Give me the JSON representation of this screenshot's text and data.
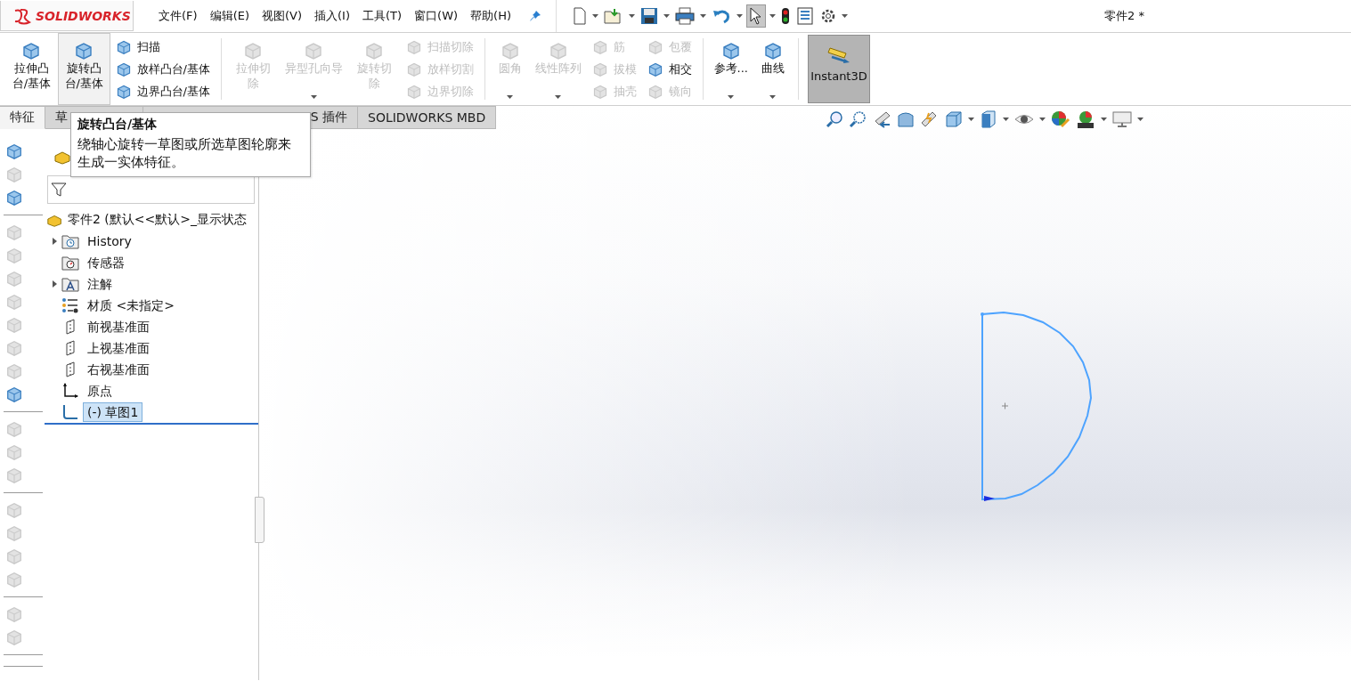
{
  "app": {
    "logo": "SOLIDWORKS"
  },
  "menu": [
    "文件(F)",
    "编辑(E)",
    "视图(V)",
    "插入(I)",
    "工具(T)",
    "窗口(W)",
    "帮助(H)"
  ],
  "quick_access": {
    "select_pressed": true
  },
  "window": {
    "title": "零件2 *"
  },
  "ribbon": [
    {
      "kind": "large",
      "label": "拉伸凸台/基体",
      "two_line": true,
      "disabled": false,
      "highlighted": false,
      "dropdown": false
    },
    {
      "kind": "large",
      "label": "旋转凸台/基体",
      "two_line": true,
      "disabled": false,
      "highlighted": true,
      "dropdown": false
    },
    {
      "kind": "stack",
      "items": [
        {
          "label": "扫描",
          "disabled": false
        },
        {
          "label": "放样凸台/基体",
          "disabled": false
        },
        {
          "label": "边界凸台/基体",
          "disabled": false
        }
      ]
    },
    {
      "kind": "separator"
    },
    {
      "kind": "large",
      "label": "拉伸切除",
      "two_line": true,
      "disabled": true,
      "highlighted": false,
      "dropdown": false
    },
    {
      "kind": "large",
      "label": "异型孔向导",
      "two_line": false,
      "disabled": true,
      "highlighted": false,
      "dropdown": true
    },
    {
      "kind": "large",
      "label": "旋转切除",
      "two_line": true,
      "disabled": true,
      "highlighted": false,
      "dropdown": false
    },
    {
      "kind": "stack",
      "items": [
        {
          "label": "扫描切除",
          "disabled": true
        },
        {
          "label": "放样切割",
          "disabled": true
        },
        {
          "label": "边界切除",
          "disabled": true
        }
      ]
    },
    {
      "kind": "separator"
    },
    {
      "kind": "large",
      "label": "圆角",
      "two_line": false,
      "disabled": true,
      "highlighted": false,
      "dropdown": true
    },
    {
      "kind": "large",
      "label": "线性阵列",
      "two_line": false,
      "disabled": true,
      "highlighted": false,
      "dropdown": true
    },
    {
      "kind": "stack",
      "items": [
        {
          "label": "筋",
          "disabled": true
        },
        {
          "label": "拔模",
          "disabled": true
        },
        {
          "label": "抽壳",
          "disabled": true
        }
      ]
    },
    {
      "kind": "stack",
      "items": [
        {
          "label": "包覆",
          "disabled": true
        },
        {
          "label": "相交",
          "disabled": false
        },
        {
          "label": "镜向",
          "disabled": true
        }
      ]
    },
    {
      "kind": "separator"
    },
    {
      "kind": "large",
      "label": "参考...",
      "two_line": false,
      "disabled": false,
      "highlighted": false,
      "dropdown": true
    },
    {
      "kind": "large",
      "label": "曲线",
      "two_line": false,
      "disabled": false,
      "highlighted": false,
      "dropdown": true
    },
    {
      "kind": "separator"
    },
    {
      "kind": "toggle",
      "label": "Instant3D",
      "selected": true
    }
  ],
  "tabs": [
    {
      "label": "特征",
      "selected": true
    },
    {
      "label": "草",
      "selected": false
    },
    {
      "label": "S 插件",
      "selected": false
    },
    {
      "label": "SOLIDWORKS MBD",
      "selected": false
    }
  ],
  "tooltip": {
    "title": "旋转凸台/基体",
    "body": "绕轴心旋转一草图或所选草图轮廓来生成一实体特征。"
  },
  "side_tools": [
    {
      "kind": "tool",
      "disabled": false
    },
    {
      "kind": "tool",
      "disabled": true
    },
    {
      "kind": "tool",
      "disabled": false
    },
    {
      "kind": "separator"
    },
    {
      "kind": "tool",
      "disabled": true
    },
    {
      "kind": "tool",
      "disabled": true
    },
    {
      "kind": "tool",
      "disabled": true
    },
    {
      "kind": "tool",
      "disabled": true
    },
    {
      "kind": "tool",
      "disabled": true
    },
    {
      "kind": "tool",
      "disabled": true
    },
    {
      "kind": "tool",
      "disabled": true
    },
    {
      "kind": "tool",
      "disabled": false
    },
    {
      "kind": "separator"
    },
    {
      "kind": "tool",
      "disabled": true
    },
    {
      "kind": "tool",
      "disabled": true
    },
    {
      "kind": "tool",
      "disabled": true
    },
    {
      "kind": "separator"
    },
    {
      "kind": "tool",
      "disabled": true
    },
    {
      "kind": "tool",
      "disabled": true
    },
    {
      "kind": "tool",
      "disabled": true
    },
    {
      "kind": "tool",
      "disabled": true
    },
    {
      "kind": "separator"
    },
    {
      "kind": "tool",
      "disabled": true
    },
    {
      "kind": "tool",
      "disabled": true
    },
    {
      "kind": "separator"
    },
    {
      "kind": "separator"
    }
  ],
  "tree": {
    "root": "零件2  (默认<<默认>_显示状态",
    "items": [
      {
        "label": "History",
        "kind": "history",
        "expandable": true,
        "selected": false
      },
      {
        "label": "传感器",
        "kind": "sensor",
        "expandable": false,
        "selected": false
      },
      {
        "label": "注解",
        "kind": "annotation",
        "expandable": true,
        "selected": false
      },
      {
        "label": "材质 <未指定>",
        "kind": "material",
        "expandable": false,
        "selected": false
      },
      {
        "label": "前视基准面",
        "kind": "plane",
        "expandable": false,
        "selected": false
      },
      {
        "label": "上视基准面",
        "kind": "plane",
        "expandable": false,
        "selected": false
      },
      {
        "label": "右视基准面",
        "kind": "plane",
        "expandable": false,
        "selected": false
      },
      {
        "label": "原点",
        "kind": "origin",
        "expandable": false,
        "selected": false
      },
      {
        "label": "(-) 草图1",
        "kind": "sketch",
        "expandable": false,
        "selected": true
      }
    ]
  }
}
